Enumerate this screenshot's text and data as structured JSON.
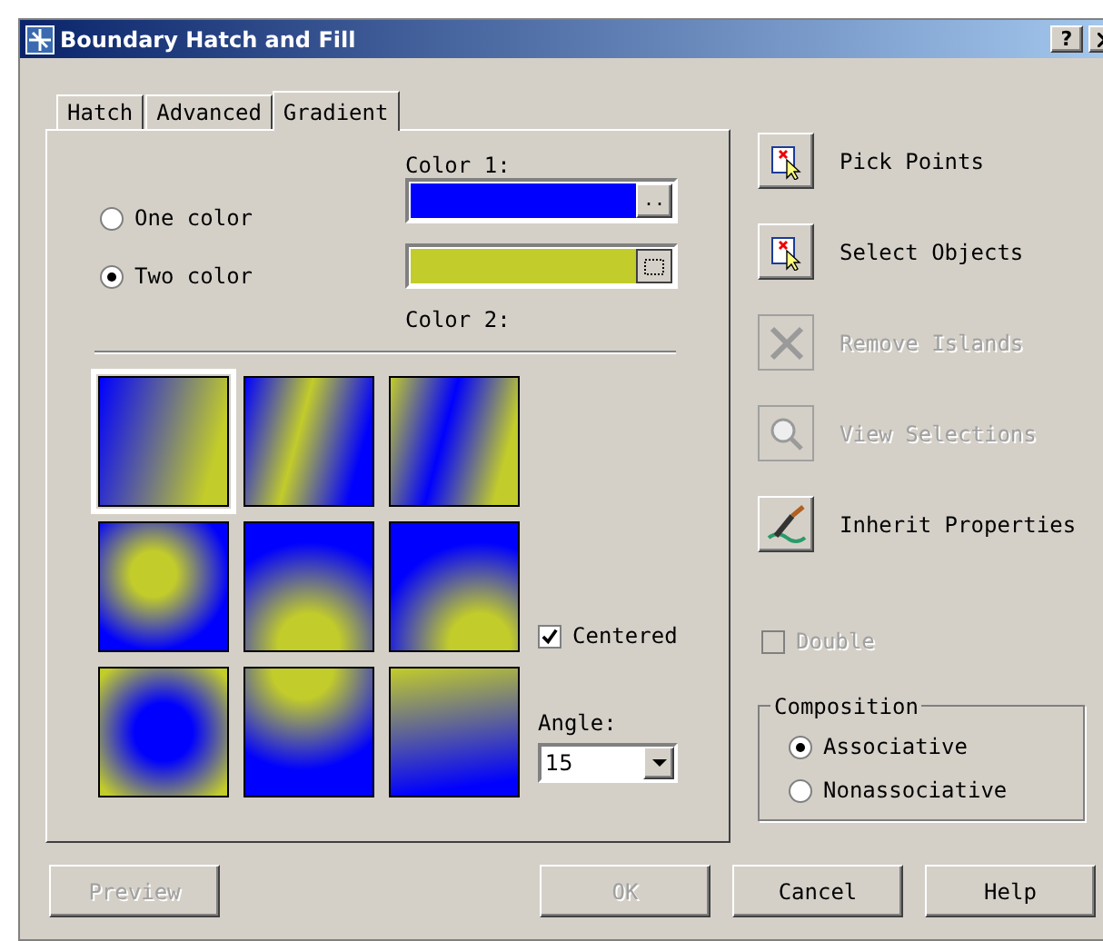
{
  "window": {
    "title": "Boundary Hatch and Fill",
    "help_button": "?"
  },
  "tabs": [
    {
      "label": "Hatch",
      "selected": false
    },
    {
      "label": "Advanced",
      "selected": false
    },
    {
      "label": "Gradient",
      "selected": true
    }
  ],
  "color_mode": [
    {
      "label": "One color",
      "selected": false
    },
    {
      "label": "Two color",
      "selected": true
    }
  ],
  "color_1": {
    "label": "Color 1:",
    "color": "#0000ff",
    "button": ".."
  },
  "color_2": {
    "label": "Color 2:",
    "color": "#c2cc2a"
  },
  "swatches": [
    {
      "selected": true
    },
    {
      "selected": false
    },
    {
      "selected": false
    },
    {
      "selected": false
    },
    {
      "selected": false
    },
    {
      "selected": false
    },
    {
      "selected": false
    },
    {
      "selected": false
    },
    {
      "selected": false
    }
  ],
  "centered": {
    "label": "Centered",
    "checked": true
  },
  "angle": {
    "label": "Angle:",
    "value": "15"
  },
  "actions": [
    {
      "kind": "pick",
      "label": "Pick Points",
      "disabled": false
    },
    {
      "kind": "select",
      "label": "Select Objects",
      "disabled": false
    },
    {
      "kind": "remove",
      "label": "Remove Islands",
      "disabled": true
    },
    {
      "kind": "view",
      "label": "View Selections",
      "disabled": true
    },
    {
      "kind": "inherit",
      "label": "Inherit Properties",
      "disabled": false
    }
  ],
  "double": {
    "label": "Double",
    "checked": false,
    "disabled": true
  },
  "composition": {
    "title": "Composition",
    "options": [
      {
        "label": "Associative",
        "selected": true
      },
      {
        "label": "Nonassociative",
        "selected": false
      }
    ]
  },
  "buttons": [
    {
      "label": "Preview",
      "disabled": true
    },
    {
      "label": "OK",
      "disabled": true
    },
    {
      "label": "Cancel",
      "disabled": false
    },
    {
      "label": "Help",
      "disabled": false
    }
  ]
}
